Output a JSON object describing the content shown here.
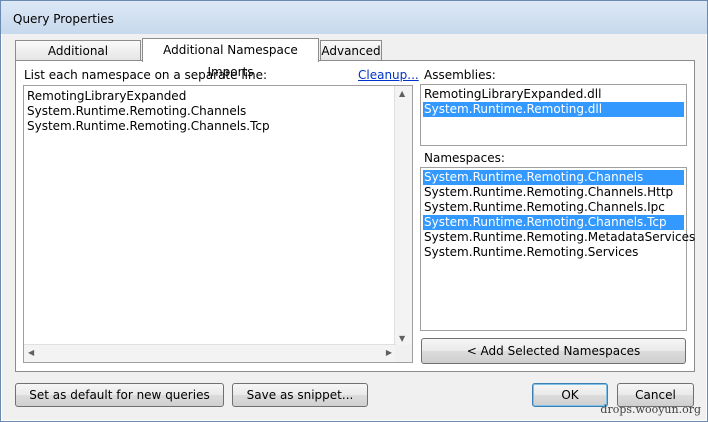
{
  "window": {
    "title": "Query Properties"
  },
  "tabs": [
    {
      "label": "Additional References"
    },
    {
      "label": "Additional Namespace Imports"
    },
    {
      "label": "Advanced"
    }
  ],
  "left": {
    "instruction": "List each namespace on a separate line:",
    "cleanup_link": "Cleanup...",
    "lines": [
      "RemotingLibraryExpanded",
      "System.Runtime.Remoting.Channels",
      "System.Runtime.Remoting.Channels.Tcp"
    ]
  },
  "assemblies": {
    "label": "Assemblies:",
    "items": [
      {
        "text": "RemotingLibraryExpanded.dll",
        "selected": false
      },
      {
        "text": "System.Runtime.Remoting.dll",
        "selected": true
      }
    ]
  },
  "namespaces": {
    "label": "Namespaces:",
    "items": [
      {
        "text": "System.Runtime.Remoting.Channels",
        "selected": true
      },
      {
        "text": "System.Runtime.Remoting.Channels.Http",
        "selected": false
      },
      {
        "text": "System.Runtime.Remoting.Channels.Ipc",
        "selected": false
      },
      {
        "text": "System.Runtime.Remoting.Channels.Tcp",
        "selected": true
      },
      {
        "text": "System.Runtime.Remoting.MetadataServices",
        "selected": false
      },
      {
        "text": "System.Runtime.Remoting.Services",
        "selected": false
      }
    ],
    "add_button": "< Add Selected Namespaces"
  },
  "footer": {
    "default_button": "Set as default for new queries",
    "snippet_button": "Save as snippet...",
    "ok_button": "OK",
    "cancel_button": "Cancel"
  },
  "watermark": "drops.wooyun.org",
  "colors": {
    "selection": "#3399ff",
    "link": "#0033cc"
  }
}
